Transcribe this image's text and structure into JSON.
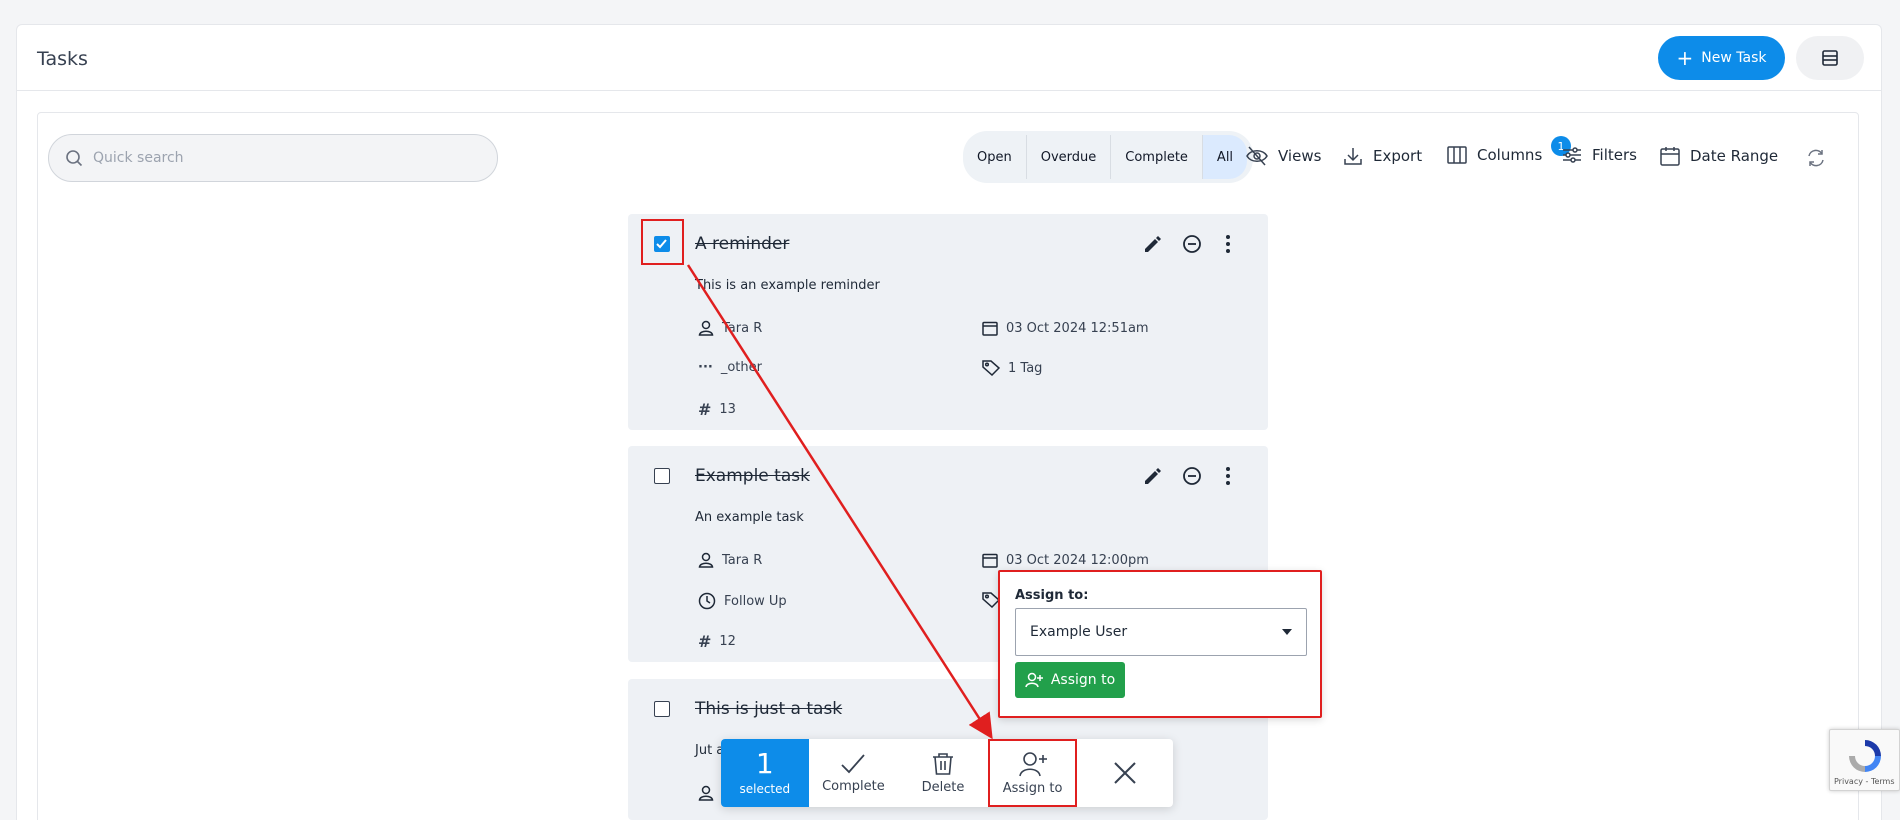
{
  "page": {
    "title": "Tasks"
  },
  "header": {
    "new_task_label": "New Task"
  },
  "search": {
    "placeholder": "Quick search"
  },
  "filters": {
    "tabs": [
      "Open",
      "Overdue",
      "Complete",
      "All"
    ],
    "active": "All"
  },
  "toolbar": {
    "views": "Views",
    "export": "Export",
    "columns": "Columns",
    "filters": "Filters",
    "filters_badge": "1",
    "date_range": "Date Range"
  },
  "tasks": [
    {
      "title": "A reminder",
      "description": "This is an example reminder",
      "assignee": "Tara R",
      "date": "03 Oct 2024 12:51am",
      "type": "_other",
      "tags": "1 Tag",
      "id": "13",
      "checked": true
    },
    {
      "title": "Example task",
      "description": "An example task",
      "assignee": "Tara R",
      "date": "03 Oct 2024 12:00pm",
      "type": "Follow Up",
      "id": "12",
      "checked": false
    },
    {
      "title": "This is just a task",
      "description": "Jut a",
      "checked": false
    }
  ],
  "assign_popup": {
    "label": "Assign to:",
    "selected_user": "Example User",
    "button_label": "Assign to"
  },
  "bulk_bar": {
    "count": "1",
    "selected_label": "selected",
    "complete": "Complete",
    "delete": "Delete",
    "assign_to": "Assign to"
  },
  "recaptcha": {
    "terms": "Privacy - Terms"
  },
  "colors": {
    "primary": "#0d8ce9",
    "success": "#22a04b",
    "annotation": "#e01f1f"
  }
}
